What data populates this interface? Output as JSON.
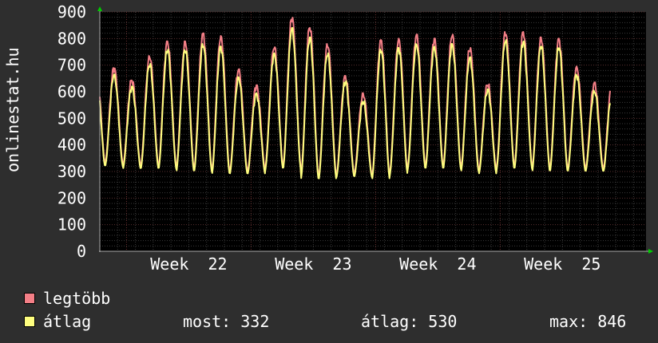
{
  "chart_data": {
    "type": "line",
    "title": "",
    "xlabel": "",
    "ylabel": "onlinestat.hu",
    "ylim": [
      0,
      900
    ],
    "yticks": [
      0,
      100,
      200,
      300,
      400,
      500,
      600,
      700,
      800,
      900
    ],
    "x_range_days": [
      0,
      30.7
    ],
    "xticks": [
      {
        "label": "Week 22",
        "day": 5.0
      },
      {
        "label": "Week 23",
        "day": 12.0
      },
      {
        "label": "Week 24",
        "day": 19.0
      },
      {
        "label": "Week 25",
        "day": 26.0
      }
    ],
    "series": [
      {
        "name": "legtöbb",
        "color": "#f47f87",
        "daily_peaks": [
          690,
          645,
          735,
          790,
          790,
          820,
          810,
          685,
          625,
          770,
          880,
          845,
          780,
          660,
          595,
          795,
          800,
          815,
          800,
          815,
          765,
          630,
          825,
          825,
          805,
          800,
          695,
          635
        ],
        "daily_lows": [
          330,
          320,
          320,
          320,
          310,
          310,
          300,
          300,
          300,
          320,
          320,
          280,
          280,
          290,
          290,
          280,
          300,
          320,
          320,
          320,
          310,
          300,
          320,
          320,
          310,
          310,
          310,
          310
        ]
      },
      {
        "name": "átlag",
        "color": "#fefe7f",
        "daily_peaks": [
          665,
          620,
          705,
          760,
          760,
          780,
          770,
          655,
          595,
          745,
          840,
          805,
          745,
          640,
          565,
          760,
          765,
          780,
          770,
          780,
          730,
          610,
          795,
          790,
          775,
          770,
          665,
          605
        ],
        "daily_lows": [
          320,
          310,
          310,
          310,
          300,
          300,
          290,
          290,
          290,
          310,
          310,
          270,
          270,
          280,
          280,
          270,
          290,
          310,
          310,
          310,
          300,
          290,
          310,
          310,
          300,
          300,
          300,
          300
        ]
      }
    ],
    "grid": true,
    "legend_position": "bottom-left"
  },
  "legend": [
    {
      "label": "legtöbb",
      "color": "#f47f87"
    },
    {
      "label": "átlag",
      "color": "#fefe7f"
    }
  ],
  "stats": {
    "now": "most: 332",
    "avg": "átlag: 530",
    "max": "max: 846"
  }
}
